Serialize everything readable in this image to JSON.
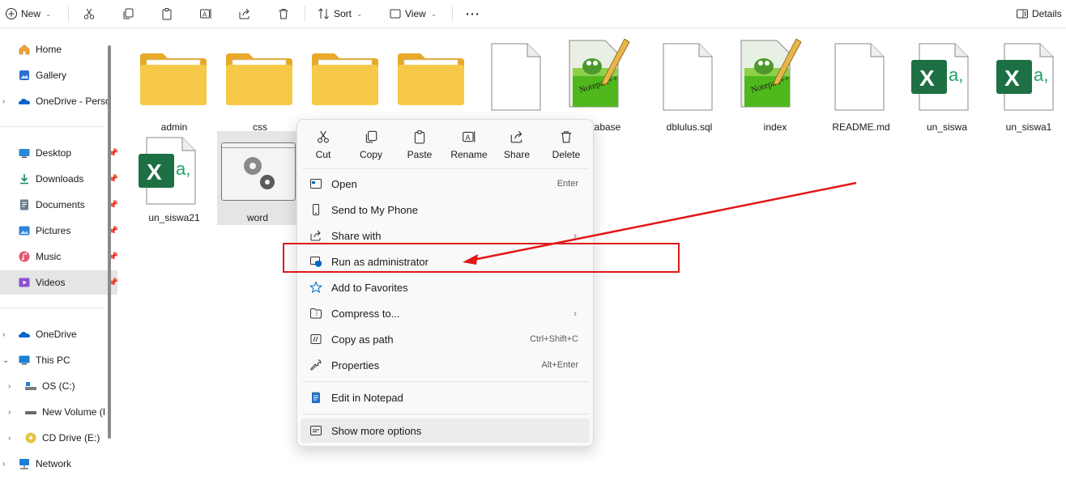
{
  "toolbar": {
    "new_label": "New",
    "sort_label": "Sort",
    "view_label": "View",
    "details_label": "Details"
  },
  "sidebar": {
    "items": [
      {
        "label": "Home",
        "icon": "home-icon"
      },
      {
        "label": "Gallery",
        "icon": "gallery-icon"
      },
      {
        "label": "OneDrive - Perso",
        "icon": "onedrive-icon"
      },
      {
        "label": "Desktop",
        "icon": "desktop-icon"
      },
      {
        "label": "Downloads",
        "icon": "downloads-icon"
      },
      {
        "label": "Documents",
        "icon": "documents-icon"
      },
      {
        "label": "Pictures",
        "icon": "pictures-icon"
      },
      {
        "label": "Music",
        "icon": "music-icon"
      },
      {
        "label": "Videos",
        "icon": "videos-icon"
      },
      {
        "label": "OneDrive",
        "icon": "onedrive-icon"
      },
      {
        "label": "This PC",
        "icon": "pc-icon"
      },
      {
        "label": "OS (C:)",
        "icon": "drive-icon"
      },
      {
        "label": "New Volume (I",
        "icon": "drive-icon"
      },
      {
        "label": "CD Drive (E:)",
        "icon": "cd-icon"
      },
      {
        "label": "Network",
        "icon": "network-icon"
      }
    ]
  },
  "files": [
    {
      "name": "admin",
      "type": "folder"
    },
    {
      "name": "css",
      "type": "folder"
    },
    {
      "name": "",
      "type": "folder"
    },
    {
      "name": "",
      "type": "folder"
    },
    {
      "name": "",
      "type": "file"
    },
    {
      "name": "atabase",
      "type": "notepad"
    },
    {
      "name": "dblulus.sql",
      "type": "file"
    },
    {
      "name": "index",
      "type": "notepad"
    },
    {
      "name": "README.md",
      "type": "file"
    },
    {
      "name": "un_siswa",
      "type": "excel"
    },
    {
      "name": "un_siswa1",
      "type": "excel"
    },
    {
      "name": "un_siswa21",
      "type": "excel"
    },
    {
      "name": "word",
      "type": "app"
    }
  ],
  "menu": {
    "quick": [
      {
        "label": "Cut"
      },
      {
        "label": "Copy"
      },
      {
        "label": "Paste"
      },
      {
        "label": "Rename"
      },
      {
        "label": "Share"
      },
      {
        "label": "Delete"
      }
    ],
    "items": [
      {
        "label": "Open",
        "shortcut": "Enter"
      },
      {
        "label": "Send to My Phone",
        "shortcut": ""
      },
      {
        "label": "Share with",
        "shortcut": ""
      },
      {
        "label": "Run as administrator",
        "shortcut": ""
      },
      {
        "label": "Add to Favorites",
        "shortcut": ""
      },
      {
        "label": "Compress to...",
        "shortcut": ""
      },
      {
        "label": "Copy as path",
        "shortcut": "Ctrl+Shift+C"
      },
      {
        "label": "Properties",
        "shortcut": "Alt+Enter"
      },
      {
        "label": "Edit in Notepad",
        "shortcut": ""
      },
      {
        "label": "Show more options",
        "shortcut": ""
      }
    ]
  },
  "colors": {
    "folder": "#F7C948",
    "excel": "#1D7044",
    "highlight": "#E01818",
    "accent": "#0067C0"
  }
}
